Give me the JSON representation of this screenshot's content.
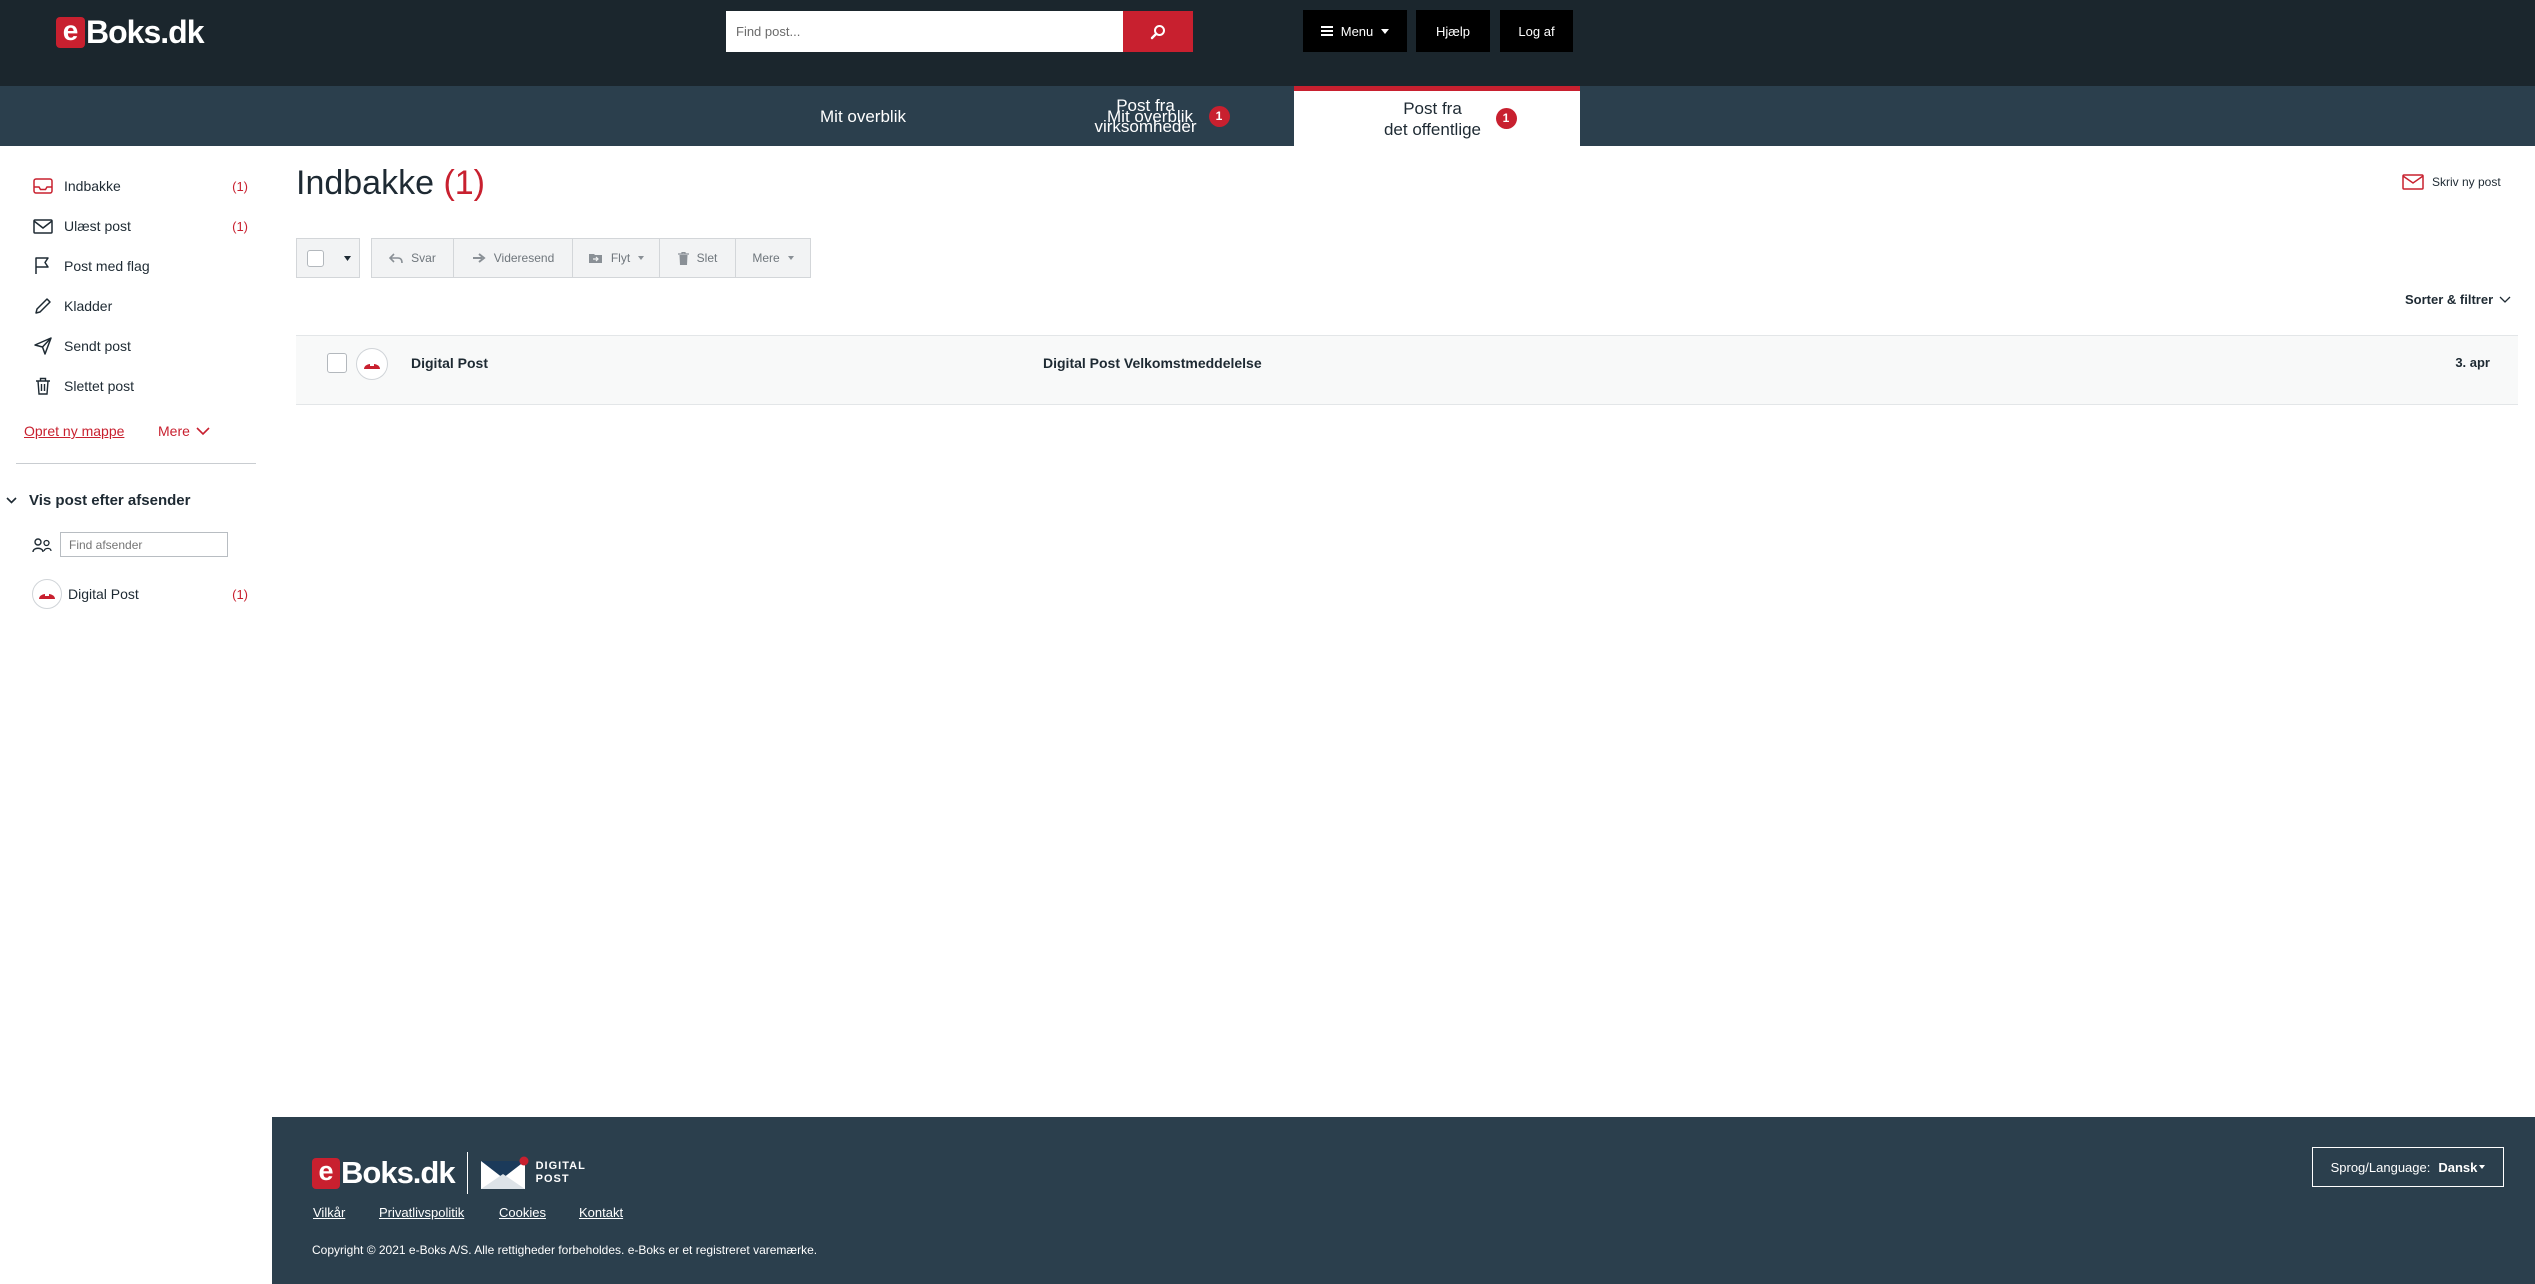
{
  "header": {
    "logo_e": "e",
    "logo_rest": "Boks.dk",
    "search_placeholder": "Find post...",
    "menu_label": "Menu",
    "help_label": "Hjælp",
    "logout_label": "Log af"
  },
  "tabs": [
    {
      "line1": "Mit overblik",
      "line2": "",
      "badge": ""
    },
    {
      "line1": "Post fra",
      "line2": "virksomheder",
      "badge": "1"
    },
    {
      "line1": "Post fra",
      "line2": "det offentlige",
      "badge": "1",
      "active": true
    }
  ],
  "sidebar": {
    "items": [
      {
        "label": "Indbakke",
        "count": "(1)",
        "icon": "inbox-icon"
      },
      {
        "label": "Ulæst post",
        "count": "(1)",
        "icon": "envelope-icon"
      },
      {
        "label": "Post med flag",
        "count": "",
        "icon": "flag-icon"
      },
      {
        "label": "Kladder",
        "count": "",
        "icon": "pencil-icon"
      },
      {
        "label": "Sendt post",
        "count": "",
        "icon": "send-icon"
      },
      {
        "label": "Slettet post",
        "count": "",
        "icon": "trash-icon"
      }
    ],
    "create_folder": "Opret ny mappe",
    "more": "Mere",
    "sender_section_title": "Vis post efter afsender",
    "sender_search_placeholder": "Find afsender",
    "senders": [
      {
        "name": "Digital Post",
        "count": "(1)"
      }
    ]
  },
  "main": {
    "title": "Indbakke",
    "title_count": "(1)",
    "compose_label": "Skriv ny post",
    "toolbar": {
      "reply": "Svar",
      "forward": "Videresend",
      "move": "Flyt",
      "delete": "Slet",
      "more": "Mere"
    },
    "sort_label": "Sorter & filtrer",
    "messages": [
      {
        "sender": "Digital Post",
        "subject": "Digital Post Velkomstmeddelelse",
        "date": "3. apr"
      }
    ]
  },
  "footer": {
    "logo_e": "e",
    "logo_rest": "Boks.dk",
    "digital_line1": "DIGITAL",
    "digital_line2": "POST",
    "links": [
      "Vilkår",
      "Privatlivspolitik",
      "Cookies",
      "Kontakt"
    ],
    "copyright": "Copyright © 2021 e-Boks A/S. Alle rettigheder forbeholdes. e-Boks er et registreret varemærke.",
    "lang_label": "Sprog/Language:",
    "lang_value": "Dansk"
  },
  "colors": {
    "brand_red": "#c8202f",
    "header_dark": "#1b262d",
    "nav_blue": "#2b3f4d"
  }
}
